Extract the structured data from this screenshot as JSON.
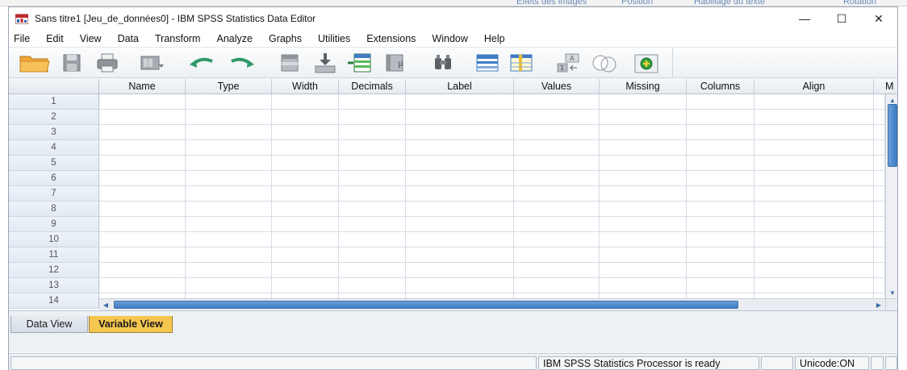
{
  "background": {
    "ribbon_items": [
      "Effets des images",
      "Position",
      "Habillage du texte",
      "Rotation"
    ]
  },
  "window": {
    "title": "Sans titre1 [Jeu_de_données0] - IBM SPSS Statistics Data Editor",
    "controls": {
      "minimize": "—",
      "maximize": "☐",
      "close": "✕"
    }
  },
  "menu": [
    "File",
    "Edit",
    "View",
    "Data",
    "Transform",
    "Analyze",
    "Graphs",
    "Utilities",
    "Extensions",
    "Window",
    "Help"
  ],
  "toolbar": {
    "buttons": [
      "open-folder",
      "save",
      "print",
      "dialog-recall",
      "undo",
      "redo",
      "go-to-case",
      "go-to-variable",
      "variables",
      "run-descriptives",
      "find",
      "insert-cases",
      "insert-variable",
      "split-file",
      "select-cases",
      "use-sets"
    ]
  },
  "grid": {
    "columns": [
      "Name",
      "Type",
      "Width",
      "Decimals",
      "Label",
      "Values",
      "Missing",
      "Columns",
      "Align",
      "M"
    ],
    "rows": [
      "1",
      "2",
      "3",
      "4",
      "5",
      "6",
      "7",
      "8",
      "9",
      "10",
      "11",
      "12",
      "13",
      "14"
    ]
  },
  "tabs": {
    "data_view": "Data View",
    "variable_view": "Variable View"
  },
  "status": {
    "processor": "IBM SPSS Statistics Processor is ready",
    "unicode": "Unicode:ON"
  },
  "colors": {
    "active_tab": "#f6c74f",
    "scroll_thumb": "#3f7cc4",
    "header_bg": "#e6ebf0"
  }
}
